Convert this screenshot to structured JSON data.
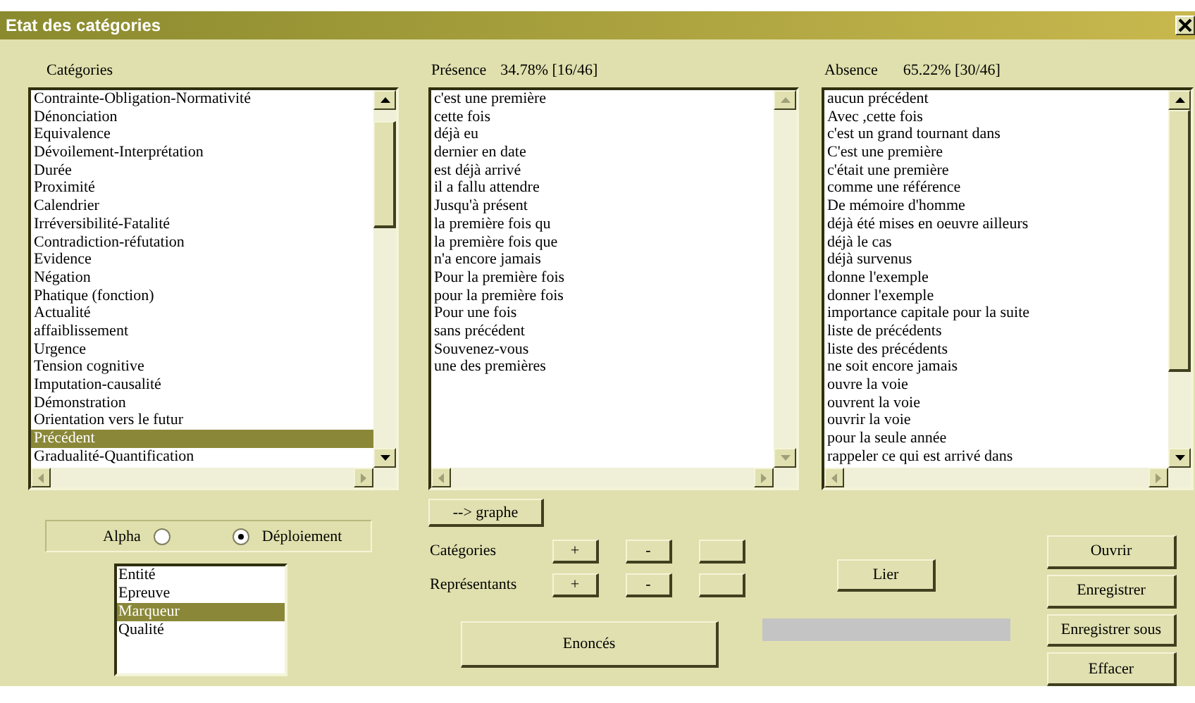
{
  "window": {
    "title": "Etat des catégories"
  },
  "categories": {
    "label": "Catégories",
    "items": [
      {
        "text": "Contrainte-Obligation-Normativité",
        "selected": false
      },
      {
        "text": "Dénonciation",
        "selected": false
      },
      {
        "text": "Equivalence",
        "selected": false
      },
      {
        "text": "Dévoilement-Interprétation",
        "selected": false
      },
      {
        "text": "Durée",
        "selected": false
      },
      {
        "text": "Proximité",
        "selected": false
      },
      {
        "text": "Calendrier",
        "selected": false
      },
      {
        "text": "Irréversibilité-Fatalité",
        "selected": false
      },
      {
        "text": "Contradiction-réfutation",
        "selected": false
      },
      {
        "text": "Evidence",
        "selected": false
      },
      {
        "text": "Négation",
        "selected": false
      },
      {
        "text": "Phatique (fonction)",
        "selected": false
      },
      {
        "text": "Actualité",
        "selected": false
      },
      {
        "text": "affaiblissement",
        "selected": false
      },
      {
        "text": "Urgence",
        "selected": false
      },
      {
        "text": "Tension cognitive",
        "selected": false
      },
      {
        "text": "Imputation-causalité",
        "selected": false
      },
      {
        "text": "Démonstration",
        "selected": false
      },
      {
        "text": "Orientation vers le futur",
        "selected": false
      },
      {
        "text": "Précédent",
        "selected": true
      },
      {
        "text": "Gradualité-Quantification",
        "selected": false
      }
    ]
  },
  "presence": {
    "label": "Présence",
    "stat": "34.78% [16/46]",
    "items": [
      "c'est une première",
      "cette fois",
      "déjà eu",
      "dernier en date",
      "est déjà arrivé",
      "il a fallu attendre",
      "Jusqu'à présent",
      "la première fois qu",
      "la première fois que",
      "n'a encore jamais",
      "Pour la première fois",
      "pour la première fois",
      "Pour une fois",
      "sans précédent",
      "Souvenez-vous",
      "une des premières"
    ]
  },
  "absence": {
    "label": "Absence",
    "stat": "65.22% [30/46]",
    "items": [
      "aucun précédent",
      "Avec ,cette fois",
      "c'est un grand tournant dans",
      "C'est une première",
      "c'était une première",
      "comme une référence",
      "De mémoire d'homme",
      "déjà été mises en oeuvre ailleurs",
      "déjà le cas",
      "déjà survenus",
      "donne l'exemple",
      "donner l'exemple",
      "importance capitale pour la suite",
      "liste de précédents",
      "liste des précédents",
      "ne soit encore jamais",
      "ouvre la voie",
      "ouvrent la voie",
      "ouvrir la voie",
      "pour la seule année",
      "rappeler ce qui est arrivé dans"
    ]
  },
  "sort": {
    "options": [
      {
        "label": "Alpha",
        "selected": false
      },
      {
        "label": "Déploiement",
        "selected": true
      }
    ]
  },
  "types": {
    "items": [
      {
        "text": "Entité",
        "selected": false
      },
      {
        "text": "Epreuve",
        "selected": false
      },
      {
        "text": "Marqueur",
        "selected": true
      },
      {
        "text": "Qualité",
        "selected": false
      }
    ]
  },
  "graph_button": "--> graphe",
  "edit_rows": [
    {
      "label": "Catégories",
      "add": "+",
      "remove": "-"
    },
    {
      "label": "Représentants",
      "add": "+",
      "remove": "-"
    }
  ],
  "enonces_button": "Enoncés",
  "link_button": "Lier",
  "actions": [
    "Ouvrir",
    "Enregistrer",
    "Enregistrer sous",
    "Effacer"
  ]
}
